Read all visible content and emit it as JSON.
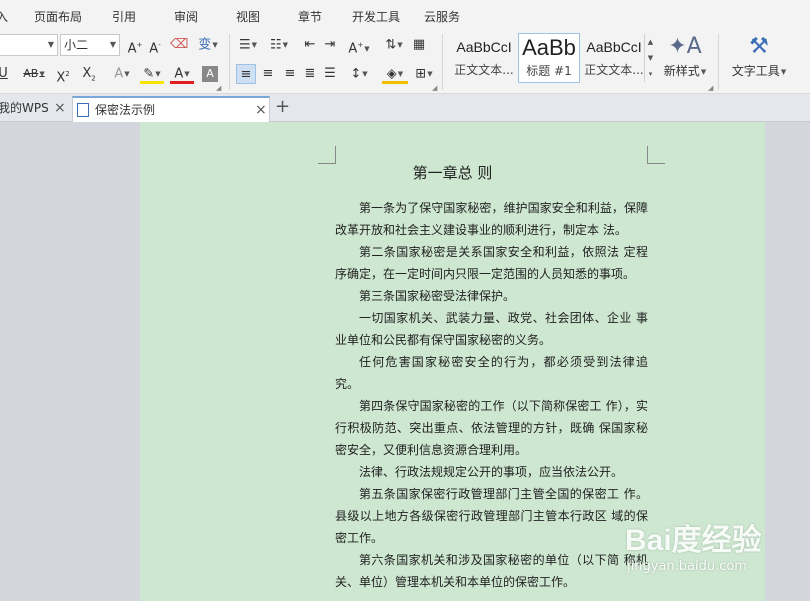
{
  "menu": {
    "tabs": [
      {
        "label": "入"
      },
      {
        "label": "页面布局"
      },
      {
        "label": "引用"
      },
      {
        "label": "审阅"
      },
      {
        "label": "视图"
      },
      {
        "label": "章节"
      },
      {
        "label": "开发工具"
      },
      {
        "label": "云服务"
      }
    ]
  },
  "ribbon": {
    "font_name": "",
    "font_size": "小二",
    "phonetic_label": "变",
    "styles": [
      {
        "sample": "AaBbCcI",
        "caption": "正文文本..."
      },
      {
        "sample": "AaBb",
        "caption": "标题 #1"
      },
      {
        "sample": "AaBbCcI",
        "caption": "正文文本..."
      }
    ],
    "new_style_label": "新样式",
    "text_tools_label": "文字工具"
  },
  "doc_tabs": {
    "tab1": "我的WPS",
    "tab2": "保密法示例"
  },
  "document": {
    "title": "第一章总  则",
    "paragraphs": [
      "第一条为了保守国家秘密，维护国家安全和利益，保障改革开放和社会主义建设事业的顺利进行，制定本 法。",
      "第二条国家秘密是关系国家安全和利益，依照法 定程序确定，在一定时间内只限一定范围的人员知悉的事项。",
      "第三条国家秘密受法律保护。",
      "一切国家机关、武装力量、政党、社会团体、企业 事业单位和公民都有保守国家秘密的义务。",
      "任何危害国家秘密安全的行为，都必须受到法律追 究。",
      "第四条保守国家秘密的工作（以下简称保密工 作），实行积极防范、突出重点、依法管理的方针，既确 保国家秘密安全，又便利信息资源合理利用。",
      "法律、行政法规规定公开的事项，应当依法公开。",
      "第五条国家保密行政管理部门主管全国的保密工 作。县级以上地方各级保密行政管理部门主管本行政区 域的保密工作。",
      "第六条国家机关和涉及国家秘密的单位（以下简 称机关、单位）管理本机关和本单位的保密工作。"
    ]
  },
  "watermark": {
    "logo": "Bai度经验",
    "url": "jingyan.baidu.com"
  },
  "colors": {
    "page_background": "#cde7d0",
    "workspace": "#d3d6dc",
    "ribbon": "#f3f3f3",
    "active_tab_accent": "#7aa7d9"
  }
}
